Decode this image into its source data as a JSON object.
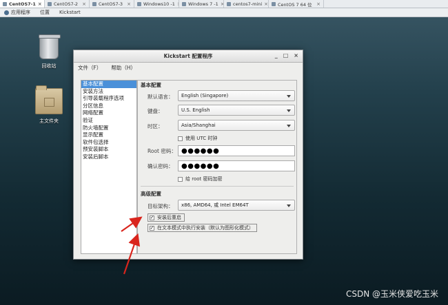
{
  "vm_tabs": [
    {
      "label": "CentOS7-1",
      "active": true
    },
    {
      "label": "CentOS7-2",
      "active": false
    },
    {
      "label": "CentOS7-3",
      "active": false
    },
    {
      "label": "Windows10 -1",
      "active": false
    },
    {
      "label": "Windows 7 -1",
      "active": false
    },
    {
      "label": "centos7-mini",
      "active": false
    },
    {
      "label": "CentOS 7 64 位",
      "active": false
    }
  ],
  "topbar": {
    "apps": "应用程序",
    "places": "位置",
    "app_name": "Kickstart"
  },
  "desktop": {
    "trash_label": "回收站",
    "home_label": "主文件夹"
  },
  "window": {
    "title": "Kickstart 配置程序",
    "menu": [
      "文件（F）",
      "帮助（H）"
    ],
    "nav": [
      "基本配置",
      "安装方法",
      "引导装载程序选项",
      "分区信息",
      "网络配置",
      "验证",
      "防火墙配置",
      "显示配置",
      "软件包选择",
      "预安装脚本",
      "安装后脚本"
    ],
    "nav_selected": 0,
    "basic": {
      "title": "基本配置",
      "lang_label": "默认语言：",
      "lang_value": "English (Singapore)",
      "keyboard_label": "键盘：",
      "keyboard_value": "U.S. English",
      "tz_label": "时区：",
      "tz_value": "Asia/Shanghai",
      "utc_label": "使用 UTC 时钟",
      "utc_checked": false,
      "root_pw_label": "Root 密码：",
      "root_pw_value": "●●●●●●",
      "confirm_pw_label": "确认密码：",
      "confirm_pw_value": "●●●●●●",
      "encrypt_label": "给 root 密码加密",
      "encrypt_checked": false
    },
    "advanced": {
      "title": "高级配置",
      "arch_label": "目标架构：",
      "arch_value": "x86, AMD64, 或 Intel EM64T",
      "reboot_label": "安装后重启",
      "reboot_checked": true,
      "textmode_label": "在文本模式中执行安装（默认为图形化模式）",
      "textmode_checked": true
    }
  },
  "colors": {
    "annotation_arrow": "#d9251d",
    "selection": "#4a90d9"
  },
  "watermark": "CSDN @玉米侠爱吃玉米"
}
